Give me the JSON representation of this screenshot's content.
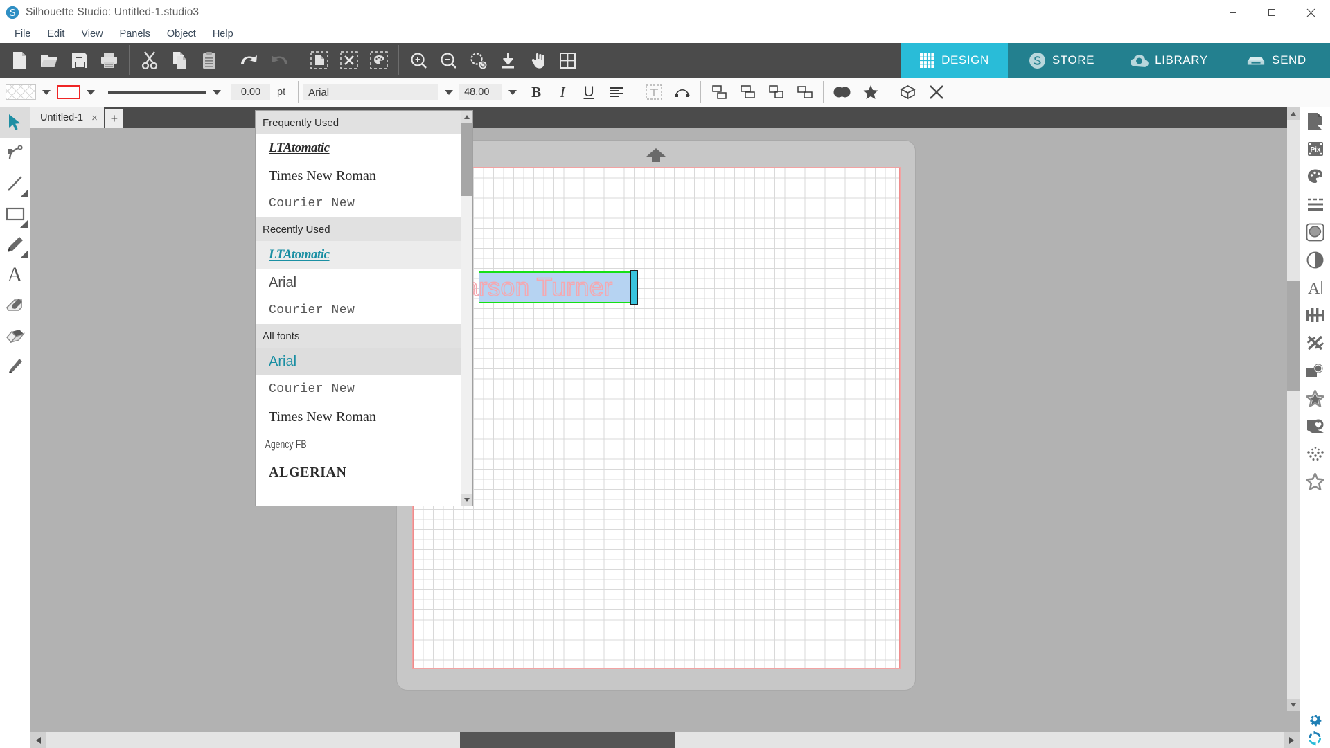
{
  "window": {
    "title": "Silhouette Studio: Untitled-1.studio3",
    "logo_icon": "silhouette-logo-icon",
    "minimize_label": "Minimize",
    "maximize_label": "Restore",
    "close_label": "Close"
  },
  "menubar": {
    "items": [
      {
        "label": "File"
      },
      {
        "label": "Edit"
      },
      {
        "label": "View"
      },
      {
        "label": "Panels"
      },
      {
        "label": "Object"
      },
      {
        "label": "Help"
      }
    ]
  },
  "toolbar": {
    "groups": [
      {
        "buttons": [
          {
            "name": "new-document-button",
            "icon": "page-icon",
            "label": "New"
          },
          {
            "name": "open-button",
            "icon": "folder-icon",
            "label": "Open"
          },
          {
            "name": "save-button",
            "icon": "floppy-disk-icon",
            "label": "Save"
          },
          {
            "name": "print-button",
            "icon": "printer-icon",
            "label": "Print"
          }
        ]
      },
      {
        "buttons": [
          {
            "name": "cut-button",
            "icon": "scissors-icon",
            "label": "Cut"
          },
          {
            "name": "copy-button",
            "icon": "copy-icon",
            "label": "Copy"
          },
          {
            "name": "paste-button",
            "icon": "clipboard-icon",
            "label": "Paste"
          }
        ]
      },
      {
        "buttons": [
          {
            "name": "undo-button",
            "icon": "undo-arrow-icon",
            "label": "Undo"
          },
          {
            "name": "redo-button",
            "icon": "redo-arrow-icon",
            "label": "Redo"
          }
        ]
      },
      {
        "buttons": [
          {
            "name": "select-all-button",
            "icon": "select-all-icon",
            "label": "Select All"
          },
          {
            "name": "deselect-all-button",
            "icon": "deselect-all-icon",
            "label": "Deselect All"
          },
          {
            "name": "select-by-color-button",
            "icon": "select-by-color-icon",
            "label": "Select by Color"
          }
        ]
      },
      {
        "buttons": [
          {
            "name": "zoom-in-button",
            "icon": "zoom-in-icon",
            "label": "Zoom In"
          },
          {
            "name": "zoom-out-button",
            "icon": "zoom-out-icon",
            "label": "Zoom Out"
          },
          {
            "name": "zoom-selection-button",
            "icon": "zoom-selection-icon",
            "label": "Zoom to Selection"
          },
          {
            "name": "fit-to-window-button",
            "icon": "fit-window-icon",
            "label": "Fit to Window"
          },
          {
            "name": "pan-button",
            "icon": "hand-pan-icon",
            "label": "Pan"
          },
          {
            "name": "fit-page-button",
            "icon": "fit-page-icon",
            "label": "Fit Page"
          }
        ]
      }
    ]
  },
  "mode_tabs": [
    {
      "label": "DESIGN",
      "icon": "grid-icon",
      "active": true
    },
    {
      "label": "STORE",
      "icon": "silhouette-logo-icon",
      "active": false
    },
    {
      "label": "LIBRARY",
      "icon": "cloud-icon",
      "active": false
    },
    {
      "label": "SEND",
      "icon": "cutter-machine-icon",
      "active": false
    }
  ],
  "style_bar": {
    "fill_swatch": {
      "name": "fill-color-swatch",
      "pattern": "hatch"
    },
    "line_swatch": {
      "name": "line-color-swatch",
      "color": "#ef2626"
    },
    "line_style": {
      "name": "line-style-preview"
    },
    "line_thickness_value": "0.00",
    "line_thickness_unit": "pt",
    "font_family_value": "Arial",
    "font_size_value": "48.00",
    "bold_label": "B",
    "italic_label": "I",
    "underline_label": "U",
    "align_label": "Align",
    "buttons": [
      {
        "name": "text-box-button",
        "icon": "text-box-icon",
        "disabled": true
      },
      {
        "name": "text-to-path-button",
        "icon": "text-to-path-icon",
        "disabled": false
      },
      {
        "name": "align-left-button",
        "icon": "align-objects-left-icon"
      },
      {
        "name": "align-center-button",
        "icon": "align-objects-center-icon"
      },
      {
        "name": "align-right-button",
        "icon": "align-objects-right-icon"
      },
      {
        "name": "align-distribute-button",
        "icon": "distribute-objects-icon"
      },
      {
        "name": "weld-button",
        "icon": "weld-icon"
      },
      {
        "name": "star-effects-button",
        "icon": "star-icon"
      },
      {
        "name": "3d-button",
        "icon": "cube-3d-icon"
      },
      {
        "name": "close-text-button",
        "icon": "close-x-icon"
      }
    ]
  },
  "left_tools": [
    {
      "name": "select-tool",
      "icon": "cursor-arrow-icon",
      "label": "Select",
      "active": true,
      "has_flyout": false
    },
    {
      "name": "edit-points-tool",
      "icon": "node-edit-icon",
      "label": "Edit Points",
      "active": false,
      "has_flyout": false
    },
    {
      "name": "line-tool",
      "icon": "line-icon",
      "label": "Draw a Line",
      "active": false,
      "has_flyout": true
    },
    {
      "name": "rectangle-tool",
      "icon": "rectangle-icon",
      "label": "Draw a Rectangle",
      "active": false,
      "has_flyout": true
    },
    {
      "name": "draw-tool",
      "icon": "pencil-icon",
      "label": "Draw Freehand",
      "active": false,
      "has_flyout": true
    },
    {
      "name": "text-tool",
      "icon": "text-a-icon",
      "label": "Draw Text",
      "active": false,
      "has_flyout": false
    },
    {
      "name": "sketch-tool",
      "icon": "sketch-pen-icon",
      "label": "Sketch",
      "active": false,
      "has_flyout": false
    },
    {
      "name": "eraser-tool",
      "icon": "eraser-icon",
      "label": "Eraser",
      "active": false,
      "has_flyout": false
    },
    {
      "name": "knife-tool",
      "icon": "knife-icon",
      "label": "Knife",
      "active": false,
      "has_flyout": false
    }
  ],
  "document_tabs": {
    "tabs": [
      {
        "label": "Untitled-1",
        "close_label": "×",
        "active": true
      }
    ],
    "add_label": "+"
  },
  "right_panels": [
    {
      "name": "panel-page-setup",
      "icon": "page-setup-icon",
      "label": "Page Setup"
    },
    {
      "name": "panel-pixscan",
      "icon": "pixscan-icon",
      "label": "PixScan"
    },
    {
      "name": "panel-fill",
      "icon": "palette-icon",
      "label": "Fill"
    },
    {
      "name": "panel-line-style",
      "icon": "line-style-icon",
      "label": "Line Style"
    },
    {
      "name": "panel-trace",
      "icon": "trace-icon",
      "label": "Trace"
    },
    {
      "name": "panel-modify",
      "icon": "contrast-circle-icon",
      "label": "Modify"
    },
    {
      "name": "panel-text-style",
      "icon": "text-style-icon",
      "label": "Text Style"
    },
    {
      "name": "panel-transform",
      "icon": "transform-sliders-icon",
      "label": "Transform"
    },
    {
      "name": "panel-offset",
      "icon": "tools-cross-icon",
      "label": "Offset"
    },
    {
      "name": "panel-replicate",
      "icon": "replicate-icon",
      "label": "Replicate"
    },
    {
      "name": "panel-design-star",
      "icon": "star-outline-icon",
      "label": "Design"
    },
    {
      "name": "panel-library",
      "icon": "library-heart-icon",
      "label": "Library"
    },
    {
      "name": "panel-stipple",
      "icon": "stipple-dots-icon",
      "label": "Stipple"
    },
    {
      "name": "panel-shapes",
      "icon": "star-shape-icon",
      "label": "Shapes"
    }
  ],
  "corner_tools": [
    {
      "name": "settings-button",
      "icon": "gear-icon",
      "label": "Preferences",
      "color": "#1f7fb5"
    },
    {
      "name": "sync-button",
      "icon": "sync-refresh-icon",
      "label": "Sync",
      "color": "#29bcd8"
    }
  ],
  "canvas": {
    "mat_arrow_icon": "mat-feed-arrow-icon",
    "text_object": {
      "name": "canvas-text-object",
      "content": "arson Turner",
      "full_text": "Carson Turner",
      "outline_color": "#f4a8b0",
      "selection_color": "#b6d3f2",
      "bounds_color": "#15e015",
      "caret_color": "#38c3dd"
    }
  },
  "font_dropdown": {
    "sections": [
      {
        "header": "Frequently Used",
        "items": [
          {
            "label": "LTAtomatic",
            "style": "script",
            "selected": false
          },
          {
            "label": "Times New Roman",
            "style": "serif",
            "selected": false
          },
          {
            "label": "Courier New",
            "style": "mono",
            "selected": false
          }
        ]
      },
      {
        "header": "Recently Used",
        "items": [
          {
            "label": "LTAtomatic",
            "style": "script",
            "selected": false,
            "highlight": true
          },
          {
            "label": "Arial",
            "style": "sans",
            "selected": false
          },
          {
            "label": "Courier New",
            "style": "mono",
            "selected": false
          }
        ]
      },
      {
        "header": "All fonts",
        "items": [
          {
            "label": "Arial",
            "style": "sans",
            "selected": true
          },
          {
            "label": "Courier New",
            "style": "mono",
            "selected": false
          },
          {
            "label": "Times New Roman",
            "style": "serif",
            "selected": false
          },
          {
            "label": "Agency FB",
            "style": "narrow",
            "selected": false
          },
          {
            "label": "ALGERIAN",
            "style": "algerian",
            "selected": false
          }
        ]
      }
    ],
    "scrollbar": {
      "up_label": "▲",
      "down_label": "▼"
    }
  },
  "scrollbars": {
    "vertical": {
      "name": "canvas-vertical-scrollbar"
    },
    "horizontal": {
      "name": "canvas-horizontal-scrollbar"
    }
  }
}
